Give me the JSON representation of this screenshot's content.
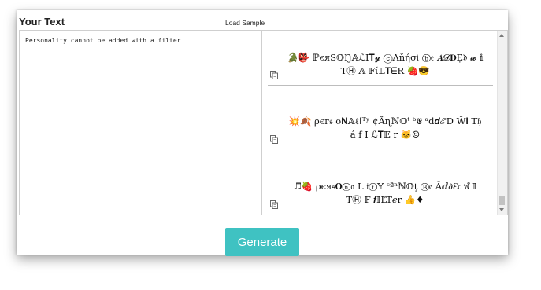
{
  "editor": {
    "title": "Your Text",
    "load_sample_label": "Load Sample",
    "input_value": "Personality cannot be added with a filter"
  },
  "results": [
    {
      "line1": "🐊👺 ℙєяЅ𝕆Ŋ𝔸ℒĪ𝐓𝔂 ⓒΛňήσ𝔱 ⓑ𝔢 𝑨𝓓𝐃Ẹ𝔡 𝔀 𝕚",
      "line2": "TⒽ 𝔸 𝔽ί𝕃𝐓ᗴR 🍓😎"
    },
    {
      "line1": "💥🍂 ρєг𝔰 o𝐍𝔸ℓ𝐈ᵀʸ ¢Ăɳℕ𝕆ᵗ ᵇ𝕰 ᵃd𝒅ℰD Ŵ𝐢 T𝔥",
      "line2": "á f I ℒ𝐓𝔼 r 🐱☺"
    },
    {
      "line1": "♬🍓 ρєя𝔰𝐎ⓝ𝔞 L 𝔦ⓣ𝕐 ᶜªⁿℕ𝕆ţ Ⓑ𝔢 Ãⅆ∂ℇ𝔠 ฬ 𝕀",
      "line2": "TⒽ 𝔽 𝒇𝕀ĽT𝑒r 👍♦"
    }
  ],
  "actions": {
    "generate_label": "Generate"
  },
  "colors": {
    "generate_bg": "#3fc2c2",
    "divider": "#bdbdbd"
  }
}
